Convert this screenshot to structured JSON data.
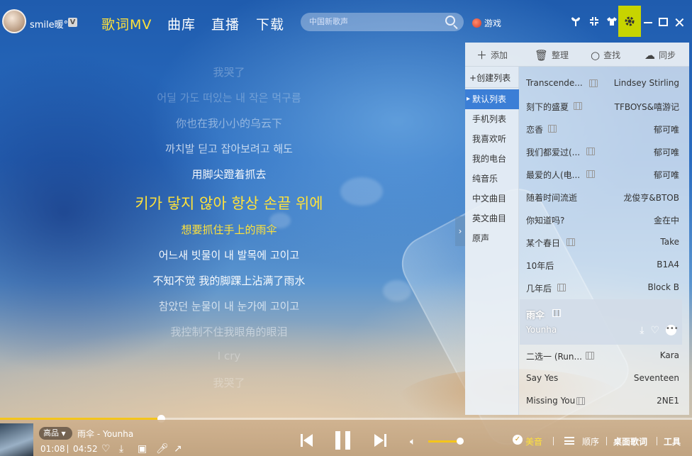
{
  "user": {
    "name": "smile暖°",
    "badge": "V"
  },
  "nav": [
    {
      "label": "歌词MV",
      "active": true
    },
    {
      "label": "曲库",
      "active": false
    },
    {
      "label": "直播",
      "active": false
    },
    {
      "label": "下载",
      "active": false
    }
  ],
  "search": {
    "placeholder": "中国新歌声"
  },
  "game_label": "游戏",
  "toolbar_icons": [
    "tree-icon",
    "compress-icon",
    "tshirt-icon",
    "gear-icon",
    "minimize-icon",
    "maximize-icon",
    "close-icon"
  ],
  "lyrics": [
    "我哭了",
    "어딜 가도 떠있는 내 작은 먹구름",
    "你也在我小小的乌云下",
    "까치발 딛고 잡아보려고 해도",
    "用脚尖蹬着抓去",
    "키가 닿지 않아 항상 손끝 위에",
    "想要抓住手上的雨伞",
    "어느새 빗물이 내 발목에 고이고",
    "不知不觉 我的脚踝上沾满了雨水",
    "참았던 눈물이 내 눈가에 고이고",
    "我控制不住我眼角的眼泪",
    "I cry",
    "我哭了"
  ],
  "playlist_toolbar": {
    "add": "添加",
    "organize": "整理",
    "find": "查找",
    "sync": "同步"
  },
  "sidebar": {
    "create": "创建列表",
    "items": [
      "默认列表",
      "手机列表",
      "我喜欢听",
      "我的电台",
      "纯音乐",
      "中文曲目",
      "英文曲目",
      "原声"
    ]
  },
  "songs": [
    {
      "title": "Transcende...",
      "artist": "Lindsey Stirling",
      "mv": true
    },
    {
      "title": "刻下的盛夏",
      "artist": "TFBOYS&嘻游记",
      "mv": true
    },
    {
      "title": "恋香",
      "artist": "郁可唯",
      "mv": true
    },
    {
      "title": "我们都爱过(...",
      "artist": "郁可唯",
      "mv": true
    },
    {
      "title": "最爱的人(电...",
      "artist": "郁可唯",
      "mv": true
    },
    {
      "title": "随着时间流逝",
      "artist": "龙俊亨&BTOB",
      "mv": false
    },
    {
      "title": "你知道吗?",
      "artist": "金在中",
      "mv": false
    },
    {
      "title": "某个春日",
      "artist": "Take",
      "mv": true
    },
    {
      "title": "10年后",
      "artist": "B1A4",
      "mv": false
    },
    {
      "title": "几年后",
      "artist": "Block B",
      "mv": true
    }
  ],
  "current_song": {
    "title": "雨伞",
    "artist": "Younha"
  },
  "songs_after": [
    {
      "title": "二选一 (Run...",
      "artist": "Kara",
      "mv": true
    },
    {
      "title": "Say Yes",
      "artist": "Seventeen",
      "mv": false
    },
    {
      "title": "Missing You",
      "artist": "2NE1",
      "mv": true
    }
  ],
  "player": {
    "quality": "高品",
    "song": "雨伞",
    "artist_suffix": " - Younha",
    "elapsed": "01:08",
    "duration": "04:52",
    "progress_fraction": 0.233,
    "volume_fraction": 0.98,
    "sound_effect": "美音",
    "order": "顺序",
    "desktop_lyrics": "桌面歌词",
    "tools": "工具"
  },
  "colors": {
    "accent": "#ffe23a",
    "progress": "#f4c51c",
    "highlight_icon_bg": "#c7d400",
    "active_list": "#3b7ed6"
  }
}
